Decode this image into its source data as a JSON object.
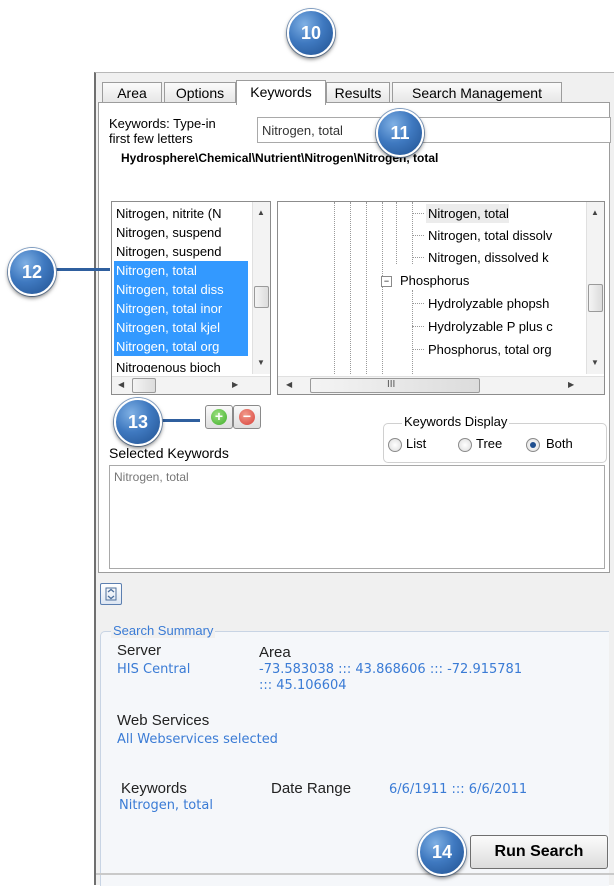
{
  "callouts": {
    "c10": "10",
    "c11": "11",
    "c12": "12",
    "c13": "13",
    "c14": "14"
  },
  "tabs": [
    {
      "label": "Area"
    },
    {
      "label": "Options"
    },
    {
      "label": "Keywords"
    },
    {
      "label": "Results"
    },
    {
      "label": "Search Management"
    }
  ],
  "keywords": {
    "label_line1": "Keywords: Type-in",
    "label_line2": "first few letters",
    "input_value": "Nitrogen, total",
    "path": "Hydrosphere\\Chemical\\Nutrient\\Nitrogen\\Nitrogen, total"
  },
  "keyword_list": [
    {
      "text": "Nitrogen, nitrite (N",
      "selected": false
    },
    {
      "text": "Nitrogen, suspend",
      "selected": false
    },
    {
      "text": "Nitrogen, suspend",
      "selected": false
    },
    {
      "text": "Nitrogen, total",
      "selected": true
    },
    {
      "text": "Nitrogen, total diss",
      "selected": true
    },
    {
      "text": "Nitrogen, total inor",
      "selected": true
    },
    {
      "text": "Nitrogen, total kjel",
      "selected": true
    },
    {
      "text": "Nitrogen, total org",
      "selected": true
    },
    {
      "text": "Nitrogenous bioch",
      "selected": false
    }
  ],
  "tree_items": [
    {
      "text": "Nitrogen, total"
    },
    {
      "text": "Nitrogen, total dissolv"
    },
    {
      "text": "Nitrogen, dissolved k"
    },
    {
      "text": "Phosphorus"
    },
    {
      "text": "Hydrolyzable phopsh"
    },
    {
      "text": "Hydrolyzable P plus c"
    },
    {
      "text": "Phosphorus, total org"
    }
  ],
  "tree_expander": "−",
  "hscroll_grip": "III",
  "keywords_display": {
    "legend": "Keywords Display",
    "options": [
      "List",
      "Tree",
      "Both"
    ],
    "selected": "Both"
  },
  "selected_keywords": {
    "label": "Selected Keywords",
    "value": "Nitrogen, total"
  },
  "summary": {
    "title": "Search Summary",
    "server_label": "Server",
    "server_value": "HIS Central",
    "area_label": "Area",
    "area_line1": "-73.583038 ::: 43.868606 ::: -72.915781",
    "area_line2": "::: 45.106604",
    "web_services_label": "Web Services",
    "web_services_value": "All Webservices selected",
    "keywords_label": "Keywords",
    "keywords_value": "Nitrogen, total",
    "date_range_label": "Date Range",
    "date_range_value": "6/6/1911 ::: 6/6/2011"
  },
  "run_search_label": "Run Search",
  "colors": {
    "selection": "#3399ff",
    "accent": "#3a7bd5",
    "callout": "#3f79c0",
    "add": "#3fae2a",
    "remove": "#d9403a"
  }
}
